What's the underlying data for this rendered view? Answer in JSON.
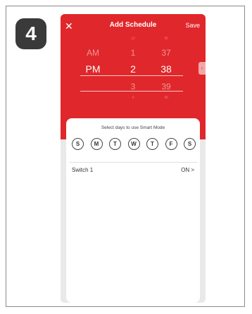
{
  "step": {
    "number": "4"
  },
  "header": {
    "close_icon": "close-icon",
    "title": "Add Schedule",
    "save_label": "Save"
  },
  "time_picker": {
    "period": [
      "",
      "",
      "AM",
      "PM",
      "",
      ""
    ],
    "hours": [
      "12",
      "1",
      "2",
      "3",
      "4"
    ],
    "minutes": [
      "36",
      "37",
      "38",
      "39",
      "40"
    ],
    "selected": {
      "period": "PM",
      "hour": "2",
      "minute": "38"
    }
  },
  "side_tab": {
    "icon": "chevron-left-icon",
    "glyph": "‹"
  },
  "days_section": {
    "title": "Select days to use Smart Mode",
    "days": [
      "S",
      "M",
      "T",
      "W",
      "T",
      "F",
      "S"
    ]
  },
  "switch_row": {
    "name": "Switch 1",
    "value": "ON",
    "chevron_icon": "chevron-right-icon"
  },
  "colors": {
    "accent": "#e0272b",
    "badge": "#3a3a3a"
  }
}
